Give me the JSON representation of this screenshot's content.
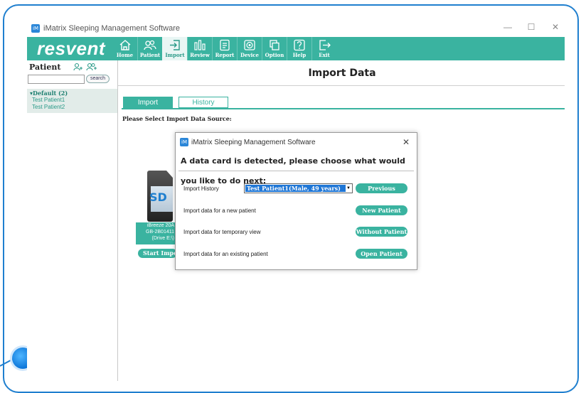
{
  "app": {
    "title": "iMatrix Sleeping Management Software",
    "logo_text": "iM"
  },
  "window_controls": {
    "minimize": "—",
    "maximize": "☐",
    "close": "✕"
  },
  "toolbar": {
    "brand": "resvent",
    "items": [
      {
        "label": "Home",
        "icon": "home-icon"
      },
      {
        "label": "Patient",
        "icon": "patient-icon"
      },
      {
        "label": "Import",
        "icon": "import-icon",
        "active": true
      },
      {
        "label": "Review",
        "icon": "review-icon"
      },
      {
        "label": "Report",
        "icon": "report-icon"
      },
      {
        "label": "Device",
        "icon": "device-icon"
      },
      {
        "label": "Option",
        "icon": "option-icon"
      },
      {
        "label": "Help",
        "icon": "help-icon"
      },
      {
        "label": "Exit",
        "icon": "exit-icon"
      }
    ]
  },
  "sidebar": {
    "heading": "Patient",
    "search_button": "search",
    "group": {
      "label": "Default (2)",
      "patients": [
        "Test Patient1",
        "Test Patient2"
      ]
    }
  },
  "main": {
    "heading": "Import Data",
    "tabs": [
      "Import",
      "History"
    ],
    "source_label": "Please Select Import Data Source:",
    "sd_card": {
      "icon_text": "SD",
      "info_lines": [
        "iBreeze 20A",
        "GB-2B01411",
        "(Drive E:\\)"
      ],
      "start_button": "Start Import"
    }
  },
  "dialog": {
    "title": "iMatrix Sleeping Management Software",
    "close": "✕",
    "message": "A data card is detected, please choose what would you like to do next:",
    "rows": [
      {
        "label": "Import History",
        "button": "Previous Patient",
        "select_value": "Test Patient1(Male, 49 years)"
      },
      {
        "label": "Import data for a new patient",
        "button": "New Patient"
      },
      {
        "label": "Import data for temporary view",
        "button": "Without Patient"
      },
      {
        "label": "Import data for an existing patient",
        "button": "Open Patient"
      }
    ]
  },
  "colors": {
    "accent": "#3ab3a0",
    "frame": "#1f7fcf",
    "selection": "#1e76d6"
  }
}
